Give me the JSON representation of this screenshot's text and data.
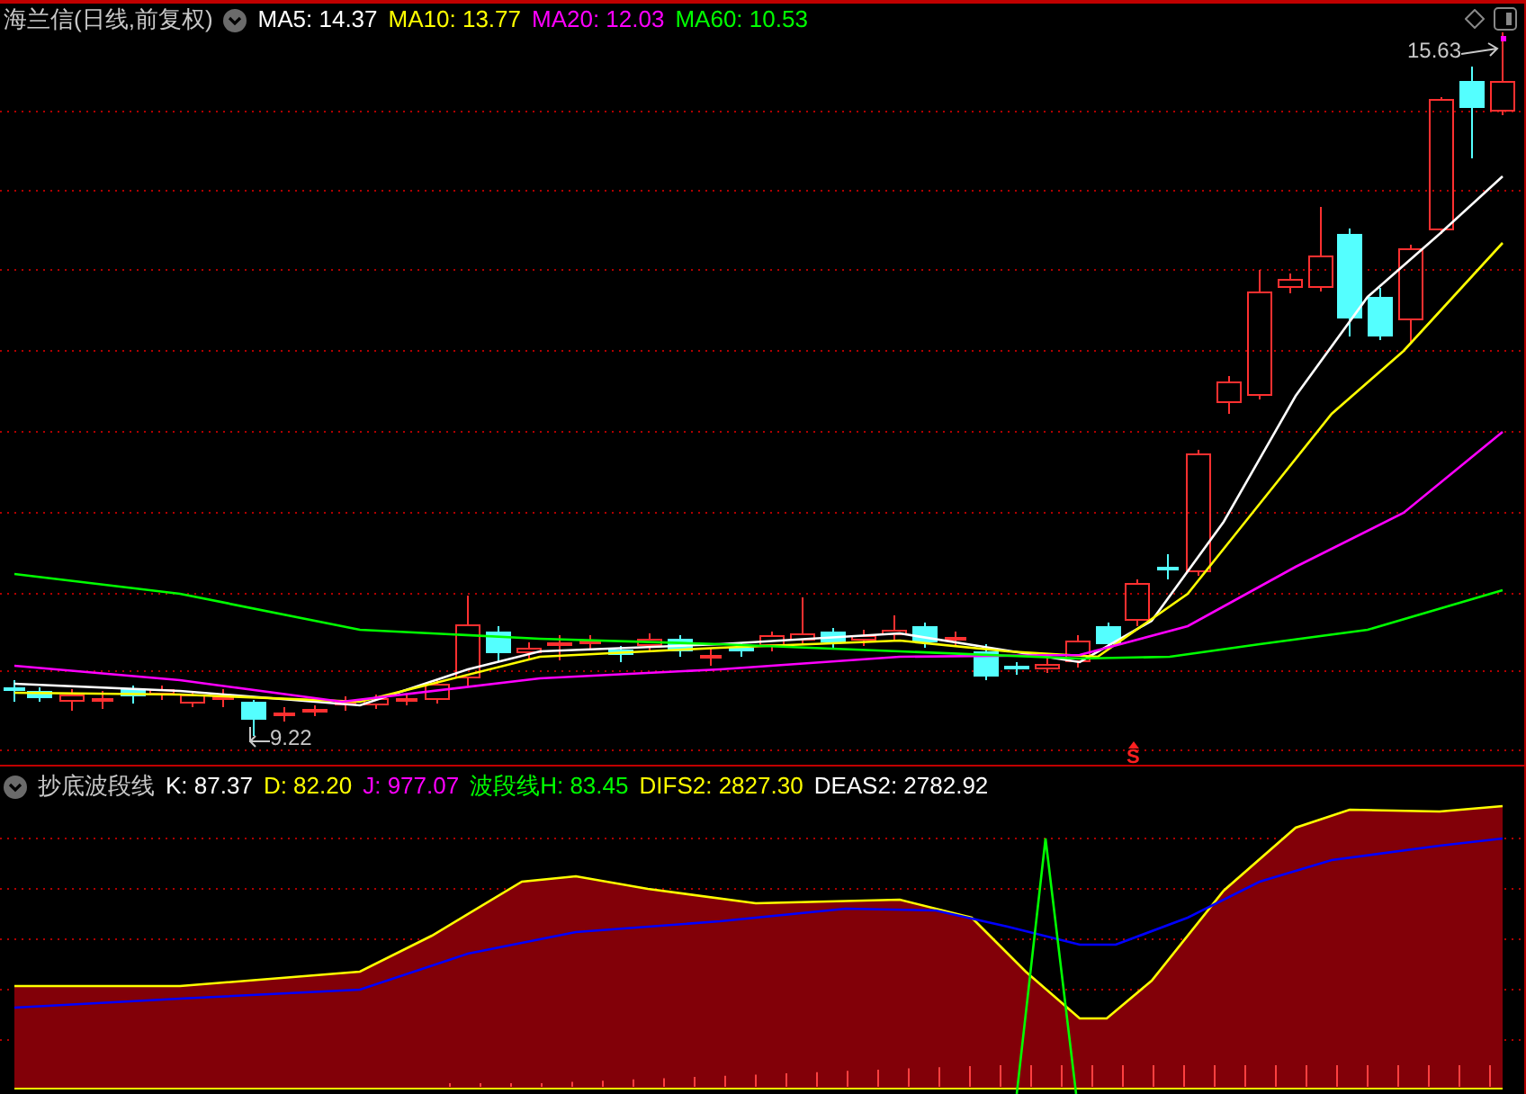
{
  "main_panel": {
    "title": "海兰信(日线,前复权)",
    "indicators": [
      {
        "label": "MA5: 14.37",
        "color": "#ffffff"
      },
      {
        "label": "MA10: 13.77",
        "color": "#ffff00"
      },
      {
        "label": "MA20: 12.03",
        "color": "#ff00ff"
      },
      {
        "label": "MA60: 10.53",
        "color": "#00ff00"
      }
    ],
    "high_label": "15.63",
    "low_label": "9.22",
    "signal_mark": "S"
  },
  "indicator_panel": {
    "title": "抄底波段线",
    "values": [
      {
        "label": "K: 87.37",
        "color": "#ffffff"
      },
      {
        "label": "D: 82.20",
        "color": "#ffff00"
      },
      {
        "label": "J: 977.07",
        "color": "#ff00ff"
      },
      {
        "label": "波段线H: 83.45",
        "color": "#00ff00"
      },
      {
        "label": "DIFS2: 2827.30",
        "color": "#ffff00"
      },
      {
        "label": "DEAS2: 2782.92",
        "color": "#ffffff"
      }
    ]
  }
}
